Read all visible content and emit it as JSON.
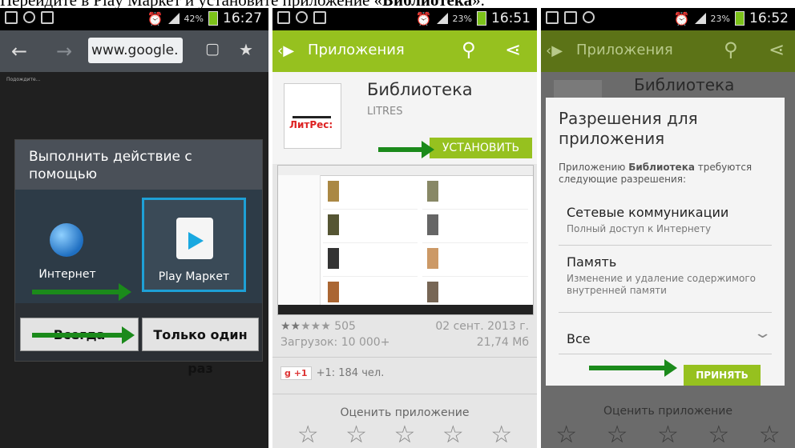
{
  "caption": {
    "prefix": "Перейдите в Play Маркет и установите приложение «",
    "app_bold": "Библиотека",
    "suffix": "»."
  },
  "screen1": {
    "status": {
      "battery": "42%",
      "time": "16:27"
    },
    "url": "www.google.",
    "tiny_text": "Подождите...",
    "dialog_title": "Выполнить действие с помощью",
    "option1": "Интернет",
    "option2": "Play Маркет",
    "btn_always": "Всегда",
    "btn_once": "Только один раз"
  },
  "screen2": {
    "status": {
      "battery": "23%",
      "time": "16:51"
    },
    "bar_title": "Приложения",
    "app_title": "Библиотека",
    "publisher": "LITRES",
    "logo_text": "ЛитРес:",
    "install": "УСТАНОВИТЬ",
    "ratings": "505",
    "date": "02 сент. 2013 г.",
    "downloads": "Загрузок: 10 000+",
    "size": "21,74 Мб",
    "gplus_badge": "+1",
    "gplus_count": "+1: 184 чел.",
    "rate_label": "Оценить приложение",
    "stars_count": "★★★★★"
  },
  "screen3": {
    "status": {
      "battery": "23%",
      "time": "16:52"
    },
    "bar_title": "Приложения",
    "bg_app_title": "Библиотека",
    "dialog_title": "Разрешения для приложения",
    "subtitle_pre": "Приложению ",
    "subtitle_app": "Библиотека",
    "subtitle_post": " требуются следующие разрешения:",
    "perm1_title": "Сетевые коммуникации",
    "perm1_desc": "Полный доступ к Интернету",
    "perm2_title": "Память",
    "perm2_desc": "Изменение и удаление содержимого внутренней памяти",
    "all": "Все",
    "accept": "ПРИНЯТЬ",
    "rate_label": "Оценить приложение"
  },
  "colors": {
    "play_green": "#96c11f",
    "arrow_green": "#1b8a1b",
    "select_blue": "#1ea0d6"
  }
}
